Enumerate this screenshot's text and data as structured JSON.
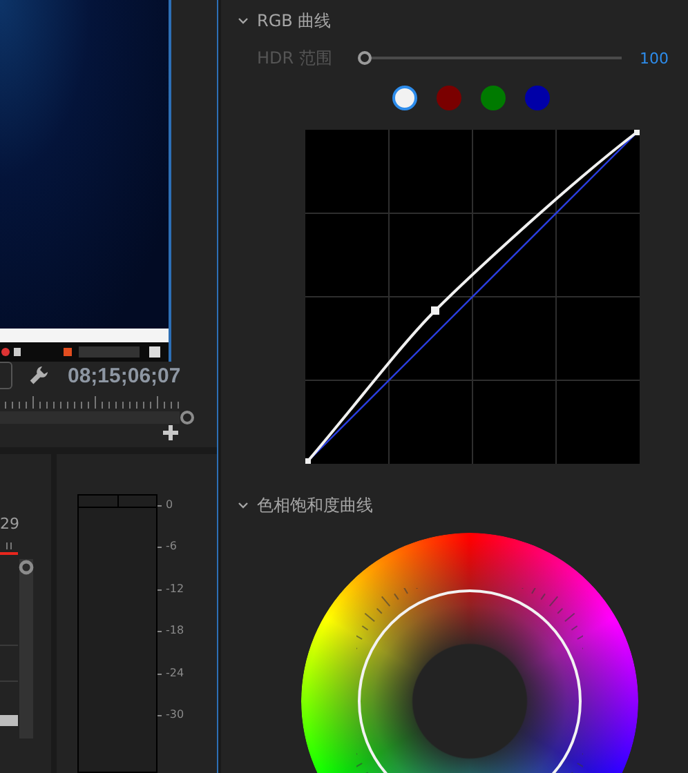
{
  "monitor": {
    "timecode": "08;15;06;07"
  },
  "audio": {
    "partial_time": "29",
    "scale": [
      "0",
      "-6",
      "-12",
      "-18",
      "-24",
      "-30"
    ]
  },
  "rgb_curves": {
    "title": "RGB 曲线",
    "expanded": true,
    "hdr_range": {
      "label": "HDR 范围",
      "disabled": true,
      "level": 0,
      "value": "100"
    },
    "channels": [
      {
        "color": "#f2f2f2",
        "selected": true
      },
      {
        "color": "#7a0000",
        "selected": false
      },
      {
        "color": "#007a00",
        "selected": false
      },
      {
        "color": "#0000a8",
        "selected": false
      }
    ]
  },
  "hue_sat_curves": {
    "title": "色相饱和度曲线",
    "expanded": true
  }
}
